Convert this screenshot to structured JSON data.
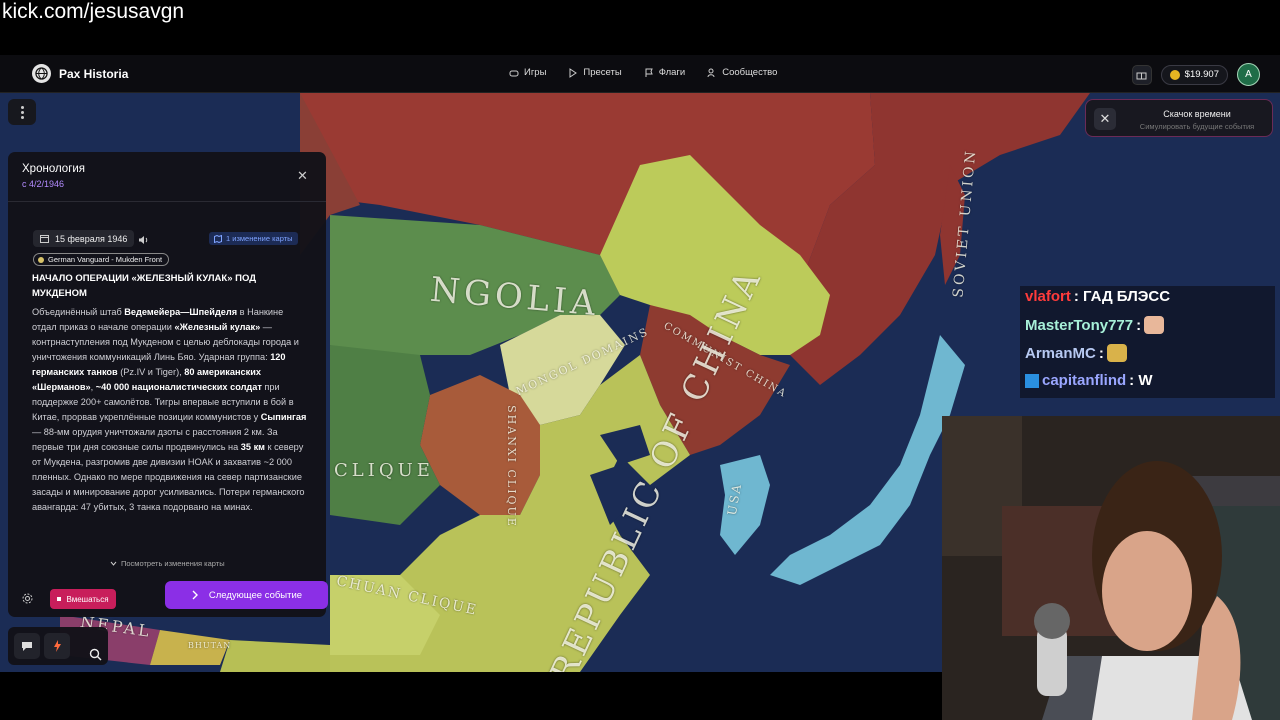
{
  "stream": {
    "url": "kick.com/jesusavgn"
  },
  "app": {
    "name": "Pax Historia",
    "nav": [
      {
        "label": "Игры",
        "icon": "gamepad-icon"
      },
      {
        "label": "Пресеты",
        "icon": "play-icon"
      },
      {
        "label": "Флаги",
        "icon": "flag-icon"
      },
      {
        "label": "Сообщество",
        "icon": "users-icon"
      }
    ],
    "balance": "$19.907",
    "avatar_letter": "A"
  },
  "timeskip": {
    "title": "Скачок времени",
    "subtitle": "Симулировать будущие события"
  },
  "timeline": {
    "title": "Хронология",
    "date": "с 4/2/1946",
    "event": {
      "date": "15 февраля 1946",
      "map_changes": "1 изменение карты",
      "tag": "German Vanguard - Mukden Front",
      "title": "НАЧАЛО ОПЕРАЦИИ «ЖЕЛЕЗНЫЙ КУЛАК» ПОД МУКДЕНОМ",
      "body": [
        {
          "t": "Объединённый штаб ",
          "b": false
        },
        {
          "t": "Ведемейера—Шпейделя",
          "b": true
        },
        {
          "t": " в Нанкине отдал приказ о начале операции ",
          "b": false
        },
        {
          "t": "«Железный кулак»",
          "b": true
        },
        {
          "t": " — контрнаступления под Мукденом с целью деблокады города и уничтожения коммуникаций Линь Бяо. Ударная группа: ",
          "b": false
        },
        {
          "t": "120 германских танков",
          "b": true
        },
        {
          "t": " (Pz.IV и Tiger), ",
          "b": false
        },
        {
          "t": "80 американских «Шерманов»",
          "b": true
        },
        {
          "t": ", ",
          "b": false
        },
        {
          "t": "~40 000 националистических солдат",
          "b": true
        },
        {
          "t": " при поддержке 200+ самолётов. Тигры впервые вступили в бой в Китае, прорвав укреплённые позиции коммунистов у ",
          "b": false
        },
        {
          "t": "Сыпингая",
          "b": true
        },
        {
          "t": " — 88-мм орудия уничтожали дзоты с расстояния 2 км. За первые три дня союзные силы продвинулись на ",
          "b": false
        },
        {
          "t": "35 км",
          "b": true
        },
        {
          "t": " к северу от Мукдена, разгромив две дивизии НОАК и захватив ~2 000 пленных. Однако по мере продвижения на север партизанские засады и минирование дорог усиливались. Потери германского авангарда: 47 убитых, 3 танка подорвано на минах.",
          "b": false
        }
      ]
    },
    "view_changes": "Посмотреть изменения карты",
    "intervene": "Вмешаться",
    "next_event": "Следующее событие"
  },
  "map": {
    "labels": {
      "mongolia": "NGOLIA",
      "mongol_domains": "MONGOL DOMAINS",
      "communist_china": "COMMUNIST CHINA",
      "republic_of_china": "REPUBLIC OF CHINA",
      "shanxi_clique": "SHANXI CLIQUE",
      "clique_west": "CLIQUE",
      "sichuan_clique": "CHUAN CLIQUE",
      "soviet_union": "SOVIET UNION",
      "nepal": "NEPAL",
      "usa": "USA",
      "bhutan": "BHUTAN"
    },
    "colors": {
      "ocean": "#1b2c55",
      "soviet": "#9a3a33",
      "mongolia": "#5c8d4d",
      "roc": "#b9c259",
      "communist": "#8e3b30",
      "mongol_domains": "#d6d99a",
      "shanxi": "#a85b3a",
      "usa": "#6fb7d0"
    }
  },
  "chat": [
    {
      "user": "vlafort",
      "color": "#ff3b3b",
      "text": ": ГАД БЛЭСС",
      "emote": ""
    },
    {
      "user": "MasterTony777",
      "color": "#a7f0d8",
      "text": ":",
      "emote": "face-emote"
    },
    {
      "user": "ArmanMC",
      "color": "#b7c9f2",
      "text": ":",
      "emote": "hand-emote"
    },
    {
      "user": "capitanflind",
      "color": "#9aa6ff",
      "text": ": W",
      "emote": "",
      "badge": "arrow-badge"
    }
  ]
}
